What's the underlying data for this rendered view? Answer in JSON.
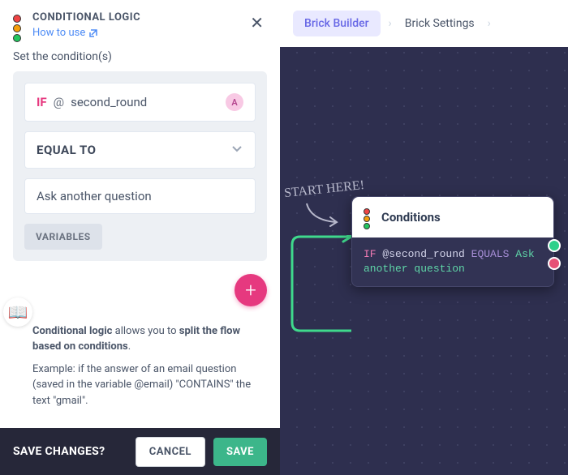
{
  "nav": {
    "tab1": "Brick Builder",
    "tab2": "Brick Settings",
    "sep": "›"
  },
  "panel": {
    "title": "CONDITIONAL LOGIC",
    "howto": "How to use",
    "subtitle": "Set the condition(s)",
    "cond": {
      "if": "IF",
      "at": "@",
      "variable": "second_round",
      "badge": "A",
      "operator": "EQUAL TO",
      "value": "Ask another question",
      "vars_btn": "VARIABLES"
    }
  },
  "help": {
    "p1_bold1": "Conditional logic",
    "p1_mid": " allows you to ",
    "p1_bold2": "split the flow based on conditions",
    "p1_end": ".",
    "p2": "Example: if the answer of an email question (saved in the variable @email) \"CONTAINS\" the text \"gmail\"."
  },
  "bottom": {
    "label": "SAVE CHANGES?",
    "cancel": "CANCEL",
    "save": "SAVE"
  },
  "canvas": {
    "start": "START HERE!",
    "node_title": "Conditions",
    "code_if": "IF",
    "code_var": "@second_round",
    "code_op": "EQUALS",
    "code_val_1": "Ask",
    "code_val_2": "another question"
  }
}
